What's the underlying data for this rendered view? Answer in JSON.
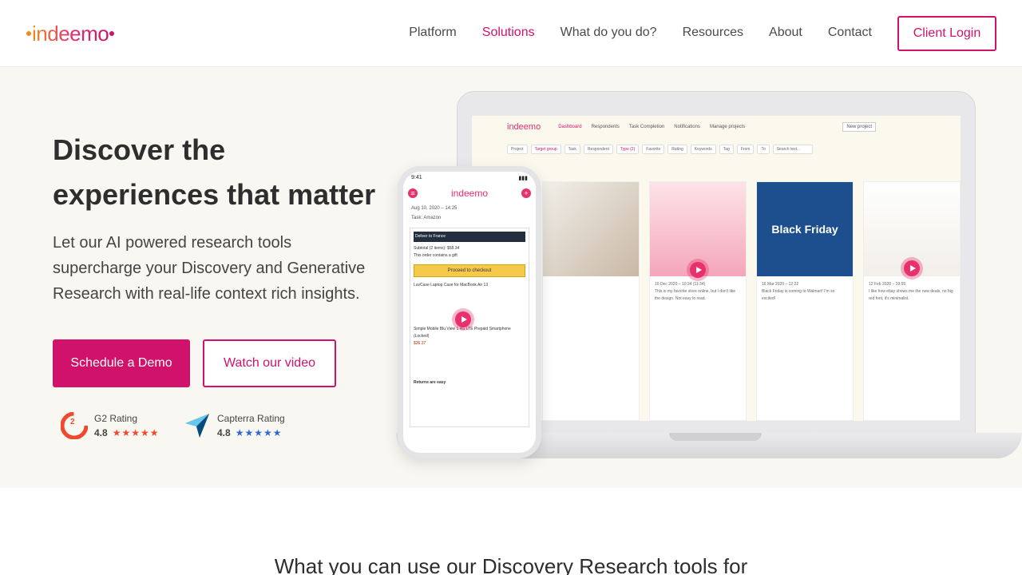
{
  "brand": {
    "logo_text": "indeemo",
    "accent": "#d0126a"
  },
  "nav": {
    "items": [
      {
        "label": "Platform",
        "active": false
      },
      {
        "label": "Solutions",
        "active": true
      },
      {
        "label": "What do you do?",
        "active": false
      },
      {
        "label": "Resources",
        "active": false
      },
      {
        "label": "About",
        "active": false
      },
      {
        "label": "Contact",
        "active": false
      }
    ],
    "login_label": "Client Login"
  },
  "hero": {
    "title_line1": "Discover the",
    "title_line2": "experiences that matter",
    "lead": "Let our AI powered research tools supercharge your Discovery and Generative Research with real-life context rich insights.",
    "cta_primary": "Schedule a Demo",
    "cta_secondary": "Watch our video"
  },
  "ratings": [
    {
      "name": "G2 Rating",
      "score": "4.8",
      "icon": "g2-logo"
    },
    {
      "name": "Capterra Rating",
      "score": "4.8",
      "icon": "capterra-logo"
    }
  ],
  "mockup": {
    "app_nav": [
      "Dashboard",
      "Respondents",
      "Task Completion",
      "Notifications",
      "Manage projects"
    ],
    "new_project": "New project",
    "filters": [
      "Project",
      "Target group",
      "Task",
      "Respondent",
      "Type (2)",
      "Favorite",
      "Rating",
      "Keywords",
      "Tag",
      "From",
      "To",
      "Search text..."
    ],
    "cards": [
      {
        "date": "",
        "text": ""
      },
      {
        "date": "10 Dec 2020 – 10:34 (11:34)",
        "text": "This is my favorite store online, but I don't like the design. Not easy to read."
      },
      {
        "date": "16 Mar 2020 – 12:22",
        "text": "Black Friday is coming to Walmart! I'm so excited!"
      },
      {
        "date": "12 Feb 2020 – 19:55",
        "text": "I like how ebay shows me the new deals, no big red font, it's minimalist."
      }
    ],
    "black_friday": "Black Friday",
    "phone": {
      "time": "9:41",
      "date": "Aug 10, 2020 – 14:25",
      "task": "Task: Amazon",
      "deliver": "Deliver to France",
      "subtotal": "Subtotal (2 items): $58.34",
      "gift": "This order contains a gift",
      "checkout": "Proceed to checkout",
      "item1": "LuvCase Laptop Case for MacBook Air 13",
      "item2": "Simple Mobile Blu View 1 4G LTE Prepaid Smartphone (Locked)",
      "price2": "$36.37",
      "returns": "Returns are easy"
    }
  },
  "next_section": {
    "title": "What you can use our Discovery Research tools for"
  }
}
